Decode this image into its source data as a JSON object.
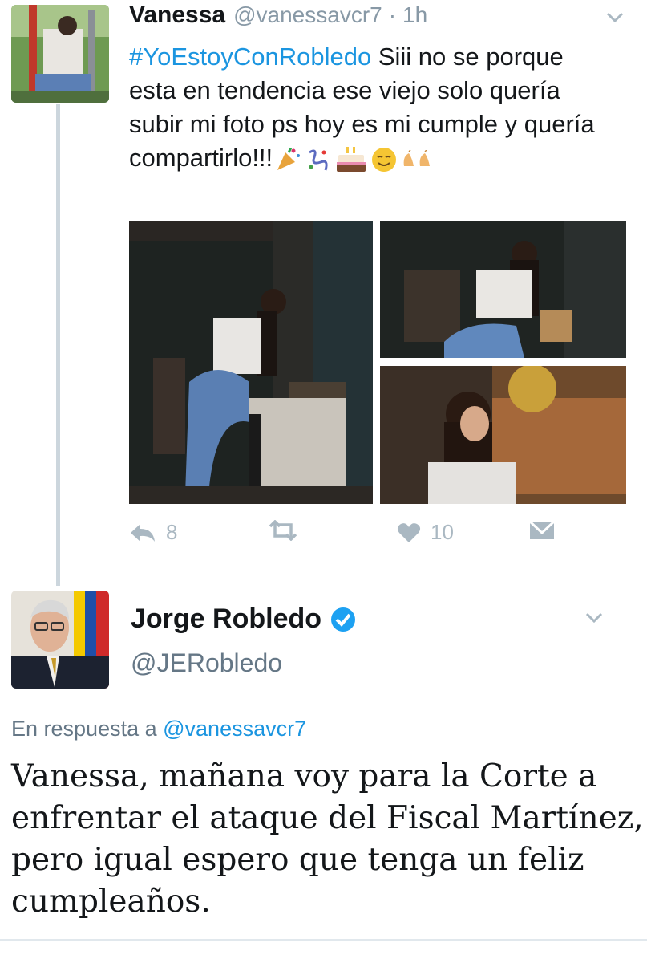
{
  "tweet1": {
    "author_name": "Vanessa",
    "handle": "@vanessavcr7",
    "separator": "·",
    "time": "1h",
    "hashtag": "#YoEstoyConRobledo",
    "text": " Siii no se porque esta en tendencia ese viejo solo quería subir mi foto ps hoy es mi cumple y quería compartirlo!!!",
    "emojis": [
      "party-popper",
      "confetti",
      "birthday-cake",
      "smiling-face",
      "clapping-hands"
    ],
    "actions": {
      "reply_count": "8",
      "retweet_count": "",
      "like_count": "10"
    }
  },
  "tweet2": {
    "author_name": "Jorge Robledo",
    "verified": true,
    "handle": "@JERobledo",
    "reply_prefix": "En respuesta a ",
    "reply_to": "@vanessavcr7",
    "text": "Vanessa, mañana voy para la Corte a enfrentar el ataque del Fiscal Martínez, pero igual espero que tenga un feliz cumpleaños."
  },
  "colors": {
    "link": "#1b95e0",
    "muted": "#8899a6",
    "action_gray": "#aab8c2",
    "thread_line": "#ccd6dd",
    "verified_badge": "#1da1f2"
  }
}
